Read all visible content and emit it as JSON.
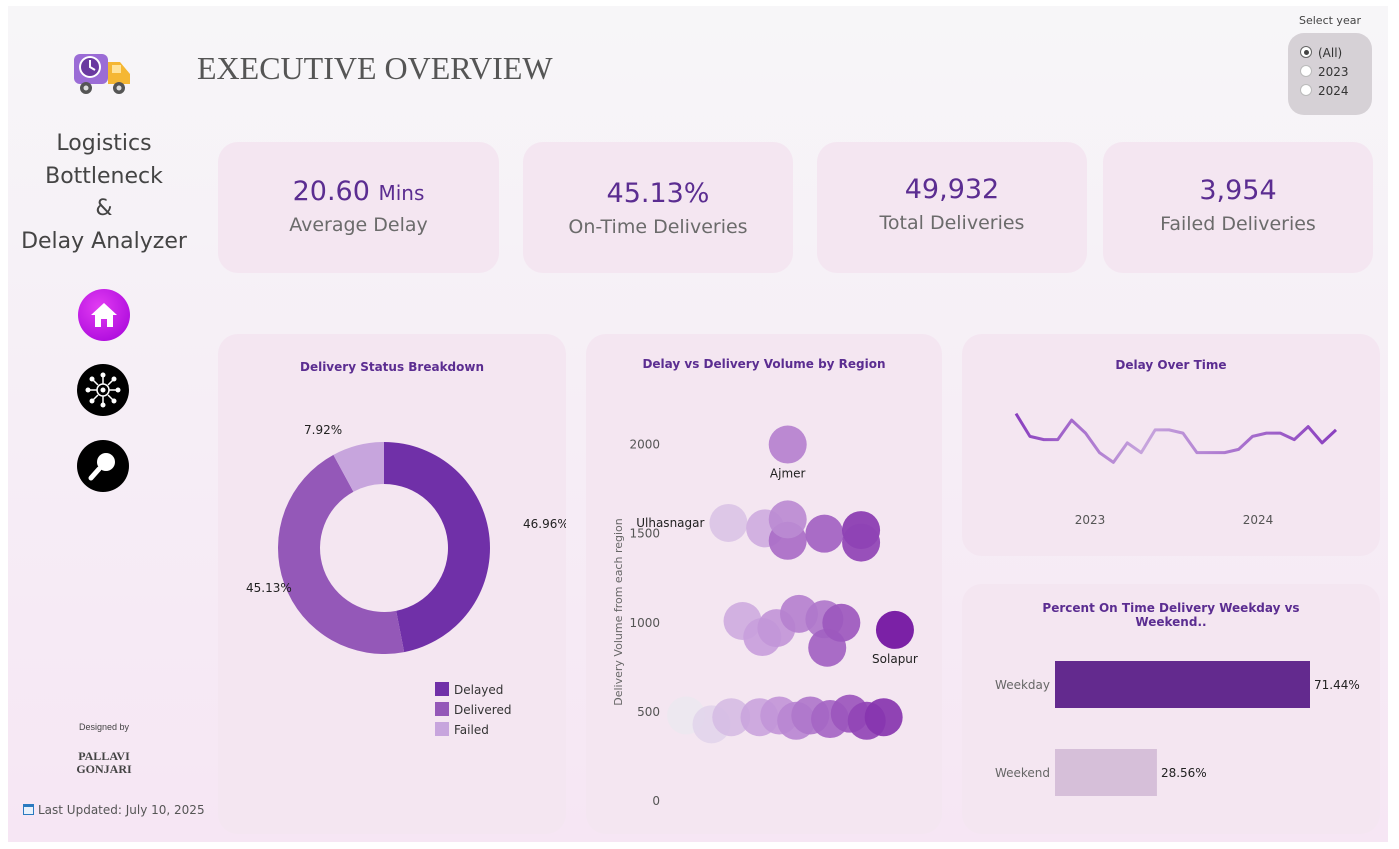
{
  "header": {
    "title": "EXECUTIVE OVERVIEW"
  },
  "sidebar": {
    "app_name_lines": [
      "Logistics",
      "Bottleneck",
      "&",
      "Delay Analyzer"
    ],
    "nav": [
      {
        "name": "home",
        "icon": "home-icon"
      },
      {
        "name": "network",
        "icon": "network-hub-icon"
      },
      {
        "name": "search",
        "icon": "magnifier-icon"
      }
    ],
    "designed_by_label": "Designed by",
    "designer_lines": [
      "PALLAVI",
      "GONJARI"
    ],
    "last_updated": "Last Updated: July 10, 2025"
  },
  "year_filter": {
    "label": "Select year",
    "options": [
      "(All)",
      "2023",
      "2024"
    ],
    "selected": "(All)"
  },
  "kpis": {
    "avg_delay": {
      "value": "20.60",
      "unit": "Mins",
      "label": "Average Delay"
    },
    "on_time": {
      "value": "45.13%",
      "label": "On-Time Deliveries"
    },
    "total": {
      "value": "49,932",
      "label": "Total Deliveries"
    },
    "failed": {
      "value": "3,954",
      "label": "Failed Deliveries"
    }
  },
  "colors": {
    "accent": "#5b2d91",
    "delayed": "#7030a8",
    "delivered": "#9458b8",
    "failed": "#c7a5dd",
    "weekday_bar": "#632a8e",
    "weekend_bar": "#d6bfd9",
    "line": "#8a3fbf"
  },
  "chart_data": [
    {
      "type": "pie",
      "variant": "donut",
      "title": "Delivery Status Breakdown",
      "categories": [
        "Delayed",
        "Delivered",
        "Failed"
      ],
      "values": [
        46.96,
        45.13,
        7.92
      ],
      "labels": [
        "46.96%",
        "45.13%",
        "7.92%"
      ],
      "legend": "bottom-right"
    },
    {
      "type": "scatter",
      "title": "Delay vs Delivery Volume by Region",
      "ylabel": "Delivery Volume from each region",
      "yticks": [
        0,
        500,
        1000,
        1500,
        2000
      ],
      "ylim": [
        0,
        2250
      ],
      "point_labels": [
        "Ajmer",
        "Ulhasnagar",
        "Solapur"
      ],
      "points": [
        {
          "x": 18.6,
          "y": 2000,
          "label": "Ajmer",
          "shade": 0.45
        },
        {
          "x": 16.5,
          "y": 1560,
          "label": "Ulhasnagar",
          "shade": 0.15
        },
        {
          "x": 17.8,
          "y": 1530,
          "shade": 0.25
        },
        {
          "x": 18.6,
          "y": 1460,
          "shade": 0.55
        },
        {
          "x": 18.6,
          "y": 1580,
          "shade": 0.4
        },
        {
          "x": 19.9,
          "y": 1500,
          "shade": 0.6
        },
        {
          "x": 21.2,
          "y": 1520,
          "shade": 0.8
        },
        {
          "x": 21.2,
          "y": 1450,
          "shade": 0.75
        },
        {
          "x": 17.0,
          "y": 1010,
          "shade": 0.25
        },
        {
          "x": 17.7,
          "y": 920,
          "shade": 0.3
        },
        {
          "x": 18.2,
          "y": 970,
          "shade": 0.35
        },
        {
          "x": 19.0,
          "y": 1050,
          "shade": 0.45
        },
        {
          "x": 19.9,
          "y": 1020,
          "shade": 0.5
        },
        {
          "x": 20.0,
          "y": 860,
          "shade": 0.6
        },
        {
          "x": 20.5,
          "y": 1000,
          "shade": 0.65
        },
        {
          "x": 22.4,
          "y": 960,
          "label": "Solapur",
          "shade": 1.0
        },
        {
          "x": 15.0,
          "y": 480,
          "shade": 0.0
        },
        {
          "x": 15.9,
          "y": 430,
          "shade": 0.08
        },
        {
          "x": 16.6,
          "y": 470,
          "shade": 0.18
        },
        {
          "x": 17.6,
          "y": 470,
          "shade": 0.28
        },
        {
          "x": 18.3,
          "y": 480,
          "shade": 0.35
        },
        {
          "x": 18.9,
          "y": 450,
          "shade": 0.42
        },
        {
          "x": 19.4,
          "y": 480,
          "shade": 0.5
        },
        {
          "x": 20.1,
          "y": 460,
          "shade": 0.58
        },
        {
          "x": 20.8,
          "y": 490,
          "shade": 0.66
        },
        {
          "x": 21.4,
          "y": 450,
          "shade": 0.74
        },
        {
          "x": 22.0,
          "y": 470,
          "shade": 0.82
        }
      ]
    },
    {
      "type": "line",
      "title": "Delay Over Time",
      "xtick_labels": [
        "2023",
        "2024"
      ],
      "x": [
        "2023-01",
        "2023-02",
        "2023-03",
        "2023-04",
        "2023-05",
        "2023-06",
        "2023-07",
        "2023-08",
        "2023-09",
        "2023-10",
        "2023-11",
        "2023-12",
        "2024-01",
        "2024-02",
        "2024-03",
        "2024-04",
        "2024-05",
        "2024-06",
        "2024-07",
        "2024-08",
        "2024-09",
        "2024-10",
        "2024-11",
        "2024-12"
      ],
      "y": [
        21.6,
        20.9,
        20.8,
        20.8,
        21.4,
        21.0,
        20.4,
        20.1,
        20.7,
        20.4,
        21.1,
        21.1,
        21.0,
        20.4,
        20.4,
        20.4,
        20.5,
        20.9,
        21.0,
        21.0,
        20.8,
        21.2,
        20.7,
        21.1
      ]
    },
    {
      "type": "bar",
      "orientation": "horizontal",
      "title": "Percent On Time Delivery Weekday vs Weekend..",
      "categories": [
        "Weekday",
        "Weekend"
      ],
      "values": [
        71.44,
        28.56
      ],
      "labels": [
        "71.44%",
        "28.56%"
      ]
    }
  ]
}
